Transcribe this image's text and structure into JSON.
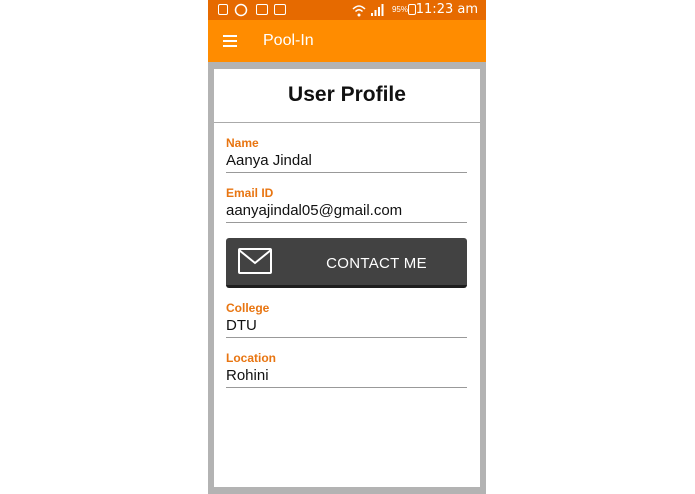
{
  "status_bar": {
    "battery": "95%",
    "time": "11:23 am"
  },
  "app_bar": {
    "title": "Pool-In"
  },
  "profile": {
    "title": "User Profile",
    "fields": [
      {
        "label": "Name",
        "value": "Aanya Jindal"
      },
      {
        "label": "Email ID",
        "value": "aanyajindal05@gmail.com"
      },
      {
        "label": "College",
        "value": "DTU"
      },
      {
        "label": "Location",
        "value": "Rohini"
      }
    ],
    "contact_label": "CONTACT ME"
  },
  "colors": {
    "status_bar": "#e66a00",
    "app_bar": "#ff8c00",
    "label": "#e87511",
    "button": "#424242"
  }
}
